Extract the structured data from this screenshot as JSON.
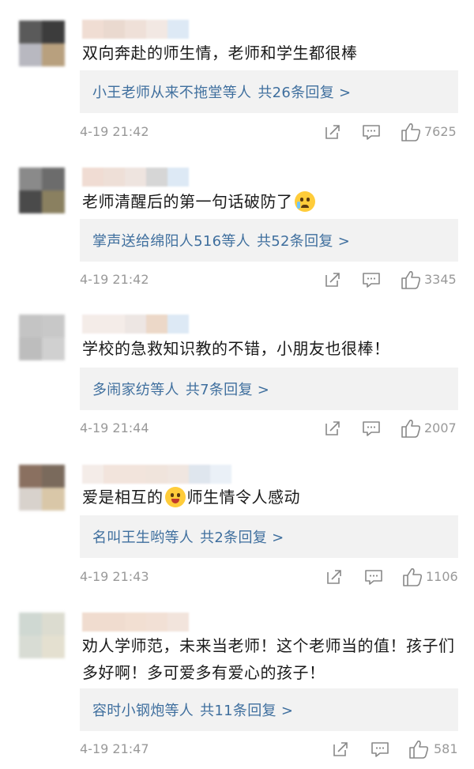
{
  "comments": [
    {
      "text_parts": [
        "双向奔赴的师生情，老师和学生都很棒"
      ],
      "emoji": "",
      "reply_users": "小王老师从来不拖堂等人",
      "reply_count": "共26条回复 >",
      "time": "4-19 21:42",
      "likes": "7625"
    },
    {
      "text_parts": [
        "老师清醒后的第一句话破防了"
      ],
      "emoji": "crying-face-emoji",
      "reply_users": "掌声送给绵阳人516等人",
      "reply_count": "共52条回复 >",
      "time": "4-19 21:42",
      "likes": "3345"
    },
    {
      "text_parts": [
        "学校的急救知识教的不错，小朋友也很棒！"
      ],
      "emoji": "",
      "reply_users": "多闹家纺等人",
      "reply_count": "共7条回复 >",
      "time": "4-19 21:44",
      "likes": "2007"
    },
    {
      "text_parts": [
        "爱是相互的",
        "师生情令人感动"
      ],
      "emoji": "grinning-face-emoji",
      "reply_users": "名叫王生哟等人",
      "reply_count": "共2条回复 >",
      "time": "4-19 21:43",
      "likes": "1106"
    },
    {
      "text_parts": [
        "劝人学师范，未来当老师！这个老师当的值！孩子们多好啊！多可爱多有爱心的孩子！"
      ],
      "emoji": "",
      "reply_users": "容时小钢炮等人",
      "reply_count": "共11条回复 >",
      "time": "4-19 21:47",
      "likes": "581"
    }
  ],
  "icons": {
    "share": "share-icon",
    "comment": "comment-icon",
    "like": "thumbs-up-icon"
  },
  "colors": {
    "link": "#3f6f9e",
    "meta": "#999999",
    "reply_bg": "#f2f2f2"
  }
}
